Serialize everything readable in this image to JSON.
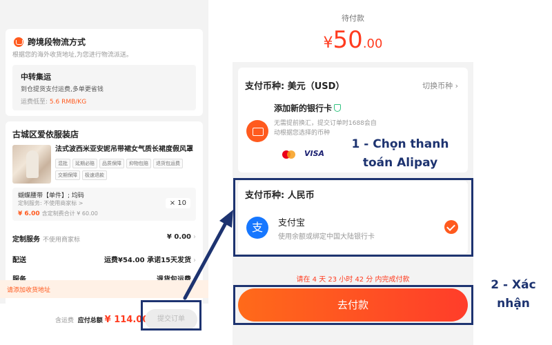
{
  "left_panel": {
    "shipping": {
      "title": "跨境段物流方式",
      "subtitle": "根据您的海外收货地址,为您进行物流派送。",
      "option_title": "中转集运",
      "option_desc": "到仓提货支付运费,多单更省钱",
      "price_label": "运费低至: ",
      "price_value": "5.6 RMB/KG"
    },
    "shop": {
      "name": "古城区爱依服装店",
      "product_title": "法式波西米亚安妮吊带裙女气质长裙度假风罩",
      "tags": [
        "混批",
        "延期必赔",
        "品质保障",
        "抑物包赔",
        "退货包运费",
        "交期保障",
        "极速退款"
      ],
      "sku_name": "蝴蝶腰带【单件】; 均码",
      "sku_custom": "定制服务: 不使用商家标 >",
      "sku_price": "¥ 6.00",
      "sku_subtotal": "含定制费合计 ¥ 60.00",
      "quantity": "× 10"
    },
    "rows": {
      "custom_label": "定制服务",
      "custom_sub": "不使用商家标",
      "custom_value": "¥ 0.00",
      "delivery_label": "配送",
      "delivery_value": "运费¥54.00",
      "delivery_promise": "承诺15天发货",
      "service_label": "服务",
      "service_value": "退货包运费"
    },
    "address_prompt": "请添加收货地址",
    "bottom": {
      "shipping_note": "含运费",
      "total_label": "应付总额",
      "total_value": "¥ 114.00",
      "submit_label": "提交订单"
    }
  },
  "right_panel": {
    "pending_label": "待付款",
    "amount_currency": "¥",
    "amount_integer": "50",
    "amount_decimal": ".00",
    "usd_label": "支付币种: 美元（USD）",
    "switch_label": "切换币种",
    "bank_title": "添加新的银行卡",
    "bank_desc": "无需提前换汇，提交订单时1688会自动根据您选择的币种",
    "visa_label": "VISA",
    "rmb_label": "支付币种: 人民币",
    "alipay_title": "支付宝",
    "alipay_desc": "使用余额或绑定中国大陆银行卡",
    "alipay_icon_char": "支",
    "deadline": "请在 4 天 23 小时 42 分 内完成付款",
    "pay_button": "去付款"
  },
  "annotations": {
    "step1": "1 - Chọn thanh toán Alipay",
    "step2": "2 - Xác nhận",
    "highlight_color": "#1d3370"
  },
  "colors": {
    "accent": "#ff5a1e",
    "price_red": "#ff3b1f",
    "alipay_blue": "#1677ff"
  }
}
